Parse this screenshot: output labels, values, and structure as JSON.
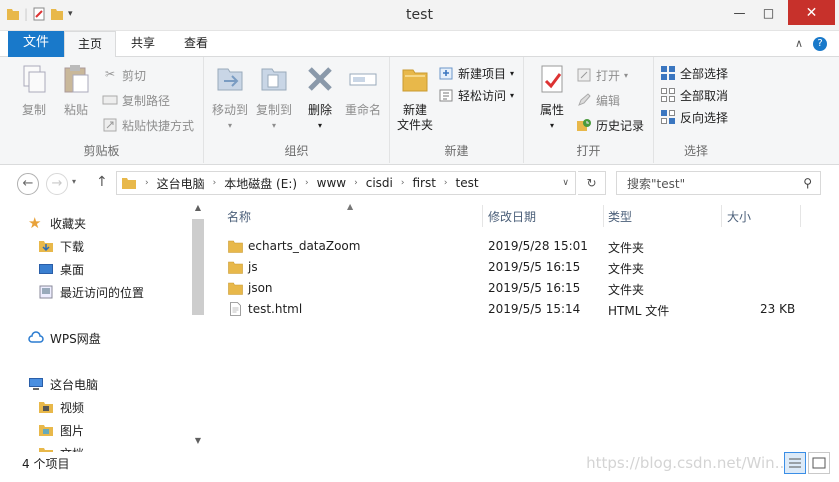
{
  "window": {
    "title": "test",
    "minimize": "—",
    "maximize": "□",
    "close": "✕"
  },
  "menubar": {
    "file_tab": "文件",
    "tabs": [
      "主页",
      "共享",
      "查看"
    ],
    "active_tab": "主页"
  },
  "ribbon": {
    "clipboard": {
      "label": "剪贴板",
      "copy": "复制",
      "paste": "粘贴",
      "cut": "剪切",
      "copy_path": "复制路径",
      "paste_shortcut": "粘贴快捷方式"
    },
    "organize": {
      "label": "组织",
      "move_to": "移动到",
      "copy_to": "复制到",
      "delete": "删除",
      "rename": "重命名"
    },
    "new": {
      "label": "新建",
      "new_folder_line1": "新建",
      "new_folder_line2": "文件夹",
      "new_item": "新建项目",
      "easy_access": "轻松访问"
    },
    "open": {
      "label": "打开",
      "properties": "属性",
      "open": "打开",
      "edit": "编辑",
      "history": "历史记录"
    },
    "select": {
      "label": "选择",
      "select_all": "全部选择",
      "select_none": "全部取消",
      "invert": "反向选择"
    }
  },
  "address": {
    "crumbs": [
      "这台电脑",
      "本地磁盘 (E:)",
      "www",
      "cisdi",
      "first",
      "test"
    ],
    "search_placeholder": "搜索\"test\""
  },
  "nav": {
    "favorites": "收藏夹",
    "downloads": "下载",
    "desktop": "桌面",
    "recent": "最近访问的位置",
    "wps": "WPS网盘",
    "this_pc": "这台电脑",
    "videos": "视频",
    "pictures": "图片",
    "documents": "文档"
  },
  "columns": {
    "name": "名称",
    "modified": "修改日期",
    "type": "类型",
    "size": "大小"
  },
  "files": [
    {
      "name": "echarts_dataZoom",
      "modified": "2019/5/28 15:01",
      "type": "文件夹",
      "size": "",
      "kind": "folder"
    },
    {
      "name": "js",
      "modified": "2019/5/5 16:15",
      "type": "文件夹",
      "size": "",
      "kind": "folder"
    },
    {
      "name": "json",
      "modified": "2019/5/5 16:15",
      "type": "文件夹",
      "size": "",
      "kind": "folder"
    },
    {
      "name": "test.html",
      "modified": "2019/5/5 15:14",
      "type": "HTML 文件",
      "size": "23 KB",
      "kind": "file"
    }
  ],
  "status": {
    "item_count": "4 个项目",
    "watermark": "https://blog.csdn.net/Win..."
  },
  "colors": {
    "file_tab": "#1979ca",
    "close_button": "#c7312b",
    "folder": "#e8b84a"
  }
}
